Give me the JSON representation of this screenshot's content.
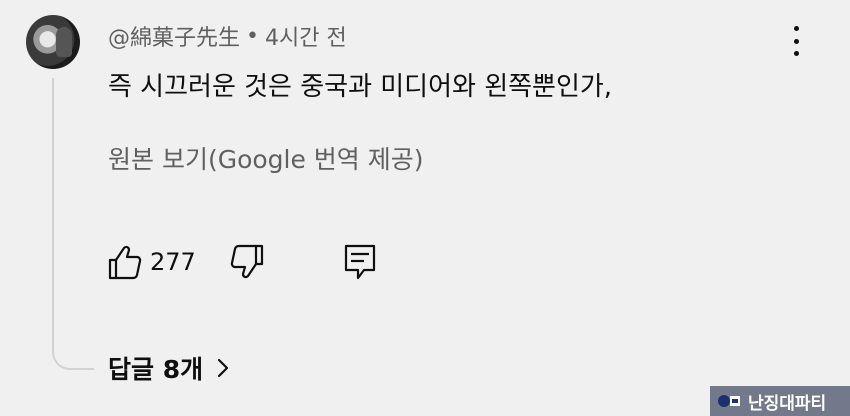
{
  "comment": {
    "author": "@綿菓子先生",
    "separator": "•",
    "timestamp": "4시간 전",
    "text": "즉 시끄러운 것은 중국과 미디어와 왼쪽뿐인가,",
    "translate_link": "원본 보기(Google 번역 제공)",
    "like_count": "277",
    "replies_label": "답글 8개"
  },
  "icons": {
    "avatar": "user-avatar",
    "menu": "kebab-menu-icon",
    "like": "thumbs-up-icon",
    "dislike": "thumbs-down-icon",
    "reply": "reply-comment-icon",
    "expand": "chevron-right-icon"
  },
  "watermark": {
    "text": "난징대파티"
  },
  "colors": {
    "background": "#f0f0f0",
    "text_primary": "#0f0f0f",
    "text_secondary": "#606060",
    "thread_line": "#d2d2d2"
  }
}
